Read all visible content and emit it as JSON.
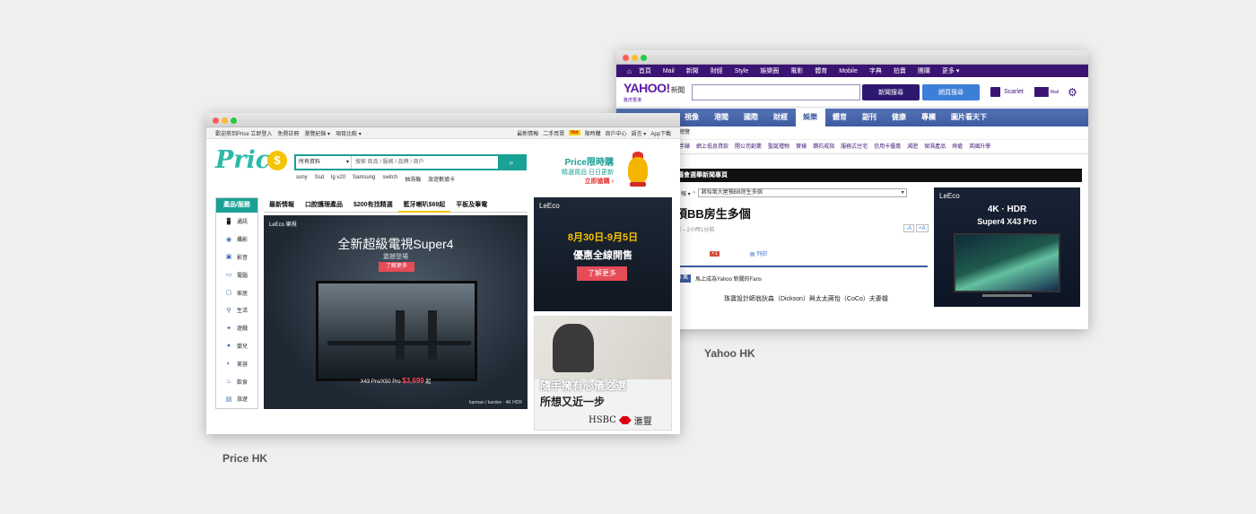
{
  "yahoo": {
    "nav": [
      "首頁",
      "Mail",
      "新聞",
      "財經",
      "Style",
      "娛樂圈",
      "電影",
      "體育",
      "Mobile",
      "字典",
      "拍賣",
      "團購",
      "更多 ▾"
    ],
    "logo": "YAHOO!",
    "logo_sub": "新聞",
    "logo_region": "雅虎香港",
    "search_btn1": "新聞搜尋",
    "search_btn2": "網頁搜尋",
    "user": "Scarlet",
    "mail_label": "Mail",
    "categories": [
      "視像",
      "港聞",
      "國際",
      "財經",
      "娛樂",
      "體育",
      "副刊",
      "健康",
      "專欄",
      "圖片看天下"
    ],
    "active_category": "娛樂",
    "subnav1": "總覽",
    "subnav2": [
      "手錶",
      "網上低息貸款",
      "開公司創業",
      "聖誕禮物",
      "實樣",
      "鑽石戒指",
      "服務式住宅",
      "信用卡優惠",
      "減肥",
      "保濕產品",
      "痔瘡",
      "英國升學"
    ],
    "section_bar": "議會選舉新聞專頁",
    "crumb_left": "日報 ▾",
    "crumb_select": "蔣怡叛大屋預BB房生多個",
    "headline": "預BB房生多個",
    "byline": "報 – 2小時1分前",
    "font_small": "-A",
    "font_large": "+A",
    "gplus": "+1",
    "print": "列印",
    "fans_badge": "4 萬",
    "fans_text": "馬上成為Yahoo 新聞的Fans",
    "story": "珠寶設計師翁狄森（Dickson）與太太蔣怡（CoCo）夫妻檔",
    "ad_brand": "LeEco",
    "ad_t1": "4K · HDR",
    "ad_t2": "Super4 X43 Pro"
  },
  "yahoo_caption": "Yahoo HK",
  "price": {
    "top_left": [
      "歡迎來到Price 立即登入",
      "免費註冊",
      "瀏覽紀錄 ▾",
      "項目比較 ▾"
    ],
    "top_right": [
      "最新情報",
      "二手買賣"
    ],
    "hot": "Hot",
    "top_right2": [
      "限時購",
      "商戶中心",
      "語言 ▾",
      "App下載"
    ],
    "logo": "Price",
    "logo_coin": "$",
    "search_category": "所有資料",
    "search_placeholder": "搜索 商品 / 服務 / 品牌 / 商戶",
    "search_icon": "search-icon",
    "tags": [
      "sony",
      "Ssd",
      "lg v20",
      "Samsung",
      "switch",
      "抽濕機",
      "旅遊數據卡"
    ],
    "promo_t1": "Price限時購",
    "promo_t2": "精選貨品 日日更新",
    "promo_t3": "立即搶購 ›",
    "side_title": "產品/服務",
    "side_items": [
      {
        "label": "通訊",
        "icon": "📱"
      },
      {
        "label": "攝影",
        "icon": "◉"
      },
      {
        "label": "影音",
        "icon": "▣"
      },
      {
        "label": "電腦",
        "icon": "▭"
      },
      {
        "label": "家居",
        "icon": "▢"
      },
      {
        "label": "生活",
        "icon": "⚲"
      },
      {
        "label": "遊戲",
        "icon": "✦"
      },
      {
        "label": "嬰兒",
        "icon": "●"
      },
      {
        "label": "美容",
        "icon": "◐"
      },
      {
        "label": "飲食",
        "icon": "♨"
      },
      {
        "label": "旅遊",
        "icon": "▤"
      }
    ],
    "tabs": [
      "最新情報",
      "口腔護理產品",
      "$200有找精選",
      "藍牙喇叭$69起",
      "平板及筆電"
    ],
    "active_tab": "藍牙喇叭$69起",
    "banner_brand": "LeEco 樂視",
    "banner_t1": "全新超級電視Super4",
    "banner_t2": "震撼登場",
    "banner_cta": "了解更多",
    "banner_price_label": "X43 Pro/X50 Pro",
    "banner_price": "$3,699",
    "banner_price_suffix": "起",
    "banner_foot": "harman / kardon · 4K HDR",
    "ad1_brand": "LeEco",
    "ad1_t1": "8月30日-9月5日",
    "ad1_t2": "優惠全線開售",
    "ad1_cta": "了解更多",
    "ad2_t1": "隨手擁有心儀之選",
    "ad2_t2": "所想又近一步",
    "ad2_hsbc": "HSBC",
    "ad2_hsbc_zh": "滙豐"
  },
  "price_caption": "Price HK"
}
